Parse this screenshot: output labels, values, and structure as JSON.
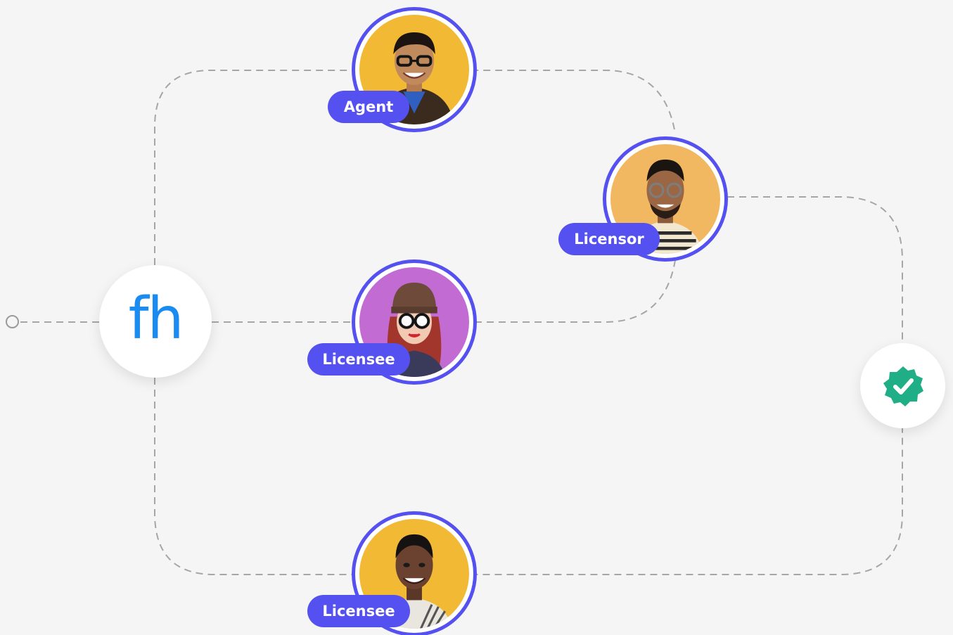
{
  "logo": {
    "text": "fh",
    "color": "#1a8bf0"
  },
  "roles": {
    "agent": "Agent",
    "licensor": "Licensor",
    "licensee_middle": "Licensee",
    "licensee_bottom": "Licensee"
  },
  "colors": {
    "accent": "#5551f0",
    "connector": "#a6a6a6",
    "verified": "#1fae86",
    "background": "#f5f5f5"
  },
  "icons": {
    "start": "start-circle-icon",
    "verified": "verified-badge-icon"
  }
}
